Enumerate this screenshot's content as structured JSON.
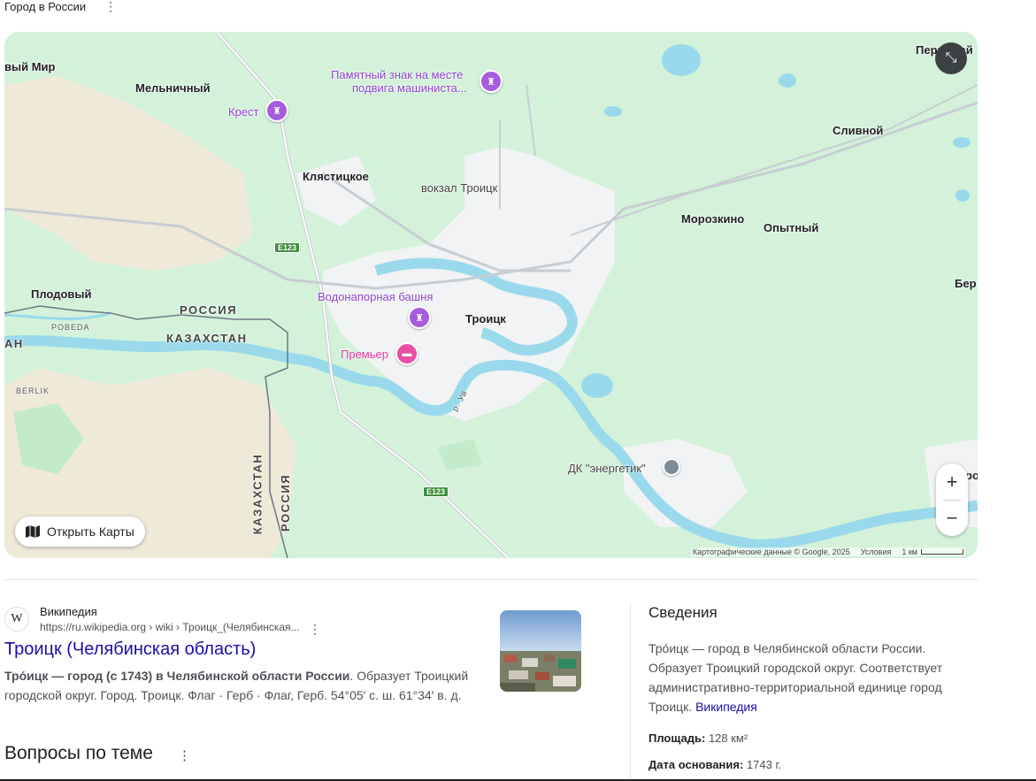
{
  "header": {
    "label": "Город в России",
    "menu_icon": "⋮"
  },
  "map": {
    "labels": {
      "mir": "вый Мир",
      "melnichny": "Мельничный",
      "krest": "Крест",
      "memorial": "Памятный знак на месте",
      "memorial2": "подвига машиниста...",
      "klyastitskoe": "Клястицкое",
      "station": "вокзал Троицк",
      "pervomaysky": "Первомай",
      "slivnoy": "Сливной",
      "moroskino": "Морозкино",
      "opytny": "Опытный",
      "ber": "Бер",
      "plodovy": "Плодовый",
      "pobeda": "POBEDA",
      "russia": "РОССИЯ",
      "kazakhstan": "КАЗАХСТАН",
      "an": "АН",
      "berlik": "BERLIK",
      "water_tower": "Водонапорная башня",
      "troitsk": "Троицк",
      "premier": "Премьер",
      "dk": "ДК \"энергетик\"",
      "ui": "р. Уй",
      "kaz_vertical": "КАЗАХСТАН",
      "rus_vertical": "РОССИЯ",
      "ro": "ро"
    },
    "shields": {
      "e123_top": "E123",
      "e123_bottom": "E123"
    },
    "open_maps": "Открыть Карты",
    "zoom_in": "+",
    "zoom_out": "−",
    "attribution": "Картографические данные © Google, 2025",
    "terms": "Условия",
    "scale": "1 км",
    "colors": {
      "land": "#d3f2d9",
      "water": "#9ad9ec",
      "urban": "#f1f3f4",
      "road": "#ffffff",
      "forest": "#c8ebcd",
      "sand": "#f0e8d8"
    }
  },
  "result": {
    "source": "Википедия",
    "url": "https://ru.wikipedia.org › wiki › Троицк_(Челябинская...",
    "title": "Троицк (Челябинская область)",
    "snippet_bold": "Тро́ицк — город (с 1743) в Челябинской области России",
    "snippet_rest": ". Образует Троицкий городской округ. Город. Троицк. Флаг · Герб · Флаг, Герб. 54°05′ с. ш. 61°34′ в. д."
  },
  "questions": {
    "title": "Вопросы по теме"
  },
  "info": {
    "title": "Сведения",
    "description": "Тро́ицк — город в Челябинской области России. Образует Троицкий городской округ. Соответствует административно-территориальной единице город Троицк.",
    "source_link": "Википедия",
    "facts": [
      {
        "label": "Площадь:",
        "value": "128 км²"
      },
      {
        "label": "Дата основания:",
        "value": "1743 г."
      }
    ]
  }
}
